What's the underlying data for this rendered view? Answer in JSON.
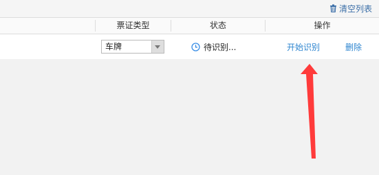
{
  "toolbar": {
    "clear_list_label": "清空列表"
  },
  "table": {
    "columns": [
      "票证类型",
      "状态",
      "操作"
    ],
    "rows": [
      {
        "ticket_type": "车牌",
        "status": "待识别...",
        "actions": {
          "start": "开始识别",
          "delete": "删除"
        }
      }
    ]
  },
  "colors": {
    "link": "#2f86d0",
    "status_icon": "#3a8ee6",
    "annotation_arrow": "#ff3b3b"
  },
  "icons": {
    "clear": "trash-icon",
    "status": "clock-icon",
    "dropdown": "chevron-down-icon"
  }
}
